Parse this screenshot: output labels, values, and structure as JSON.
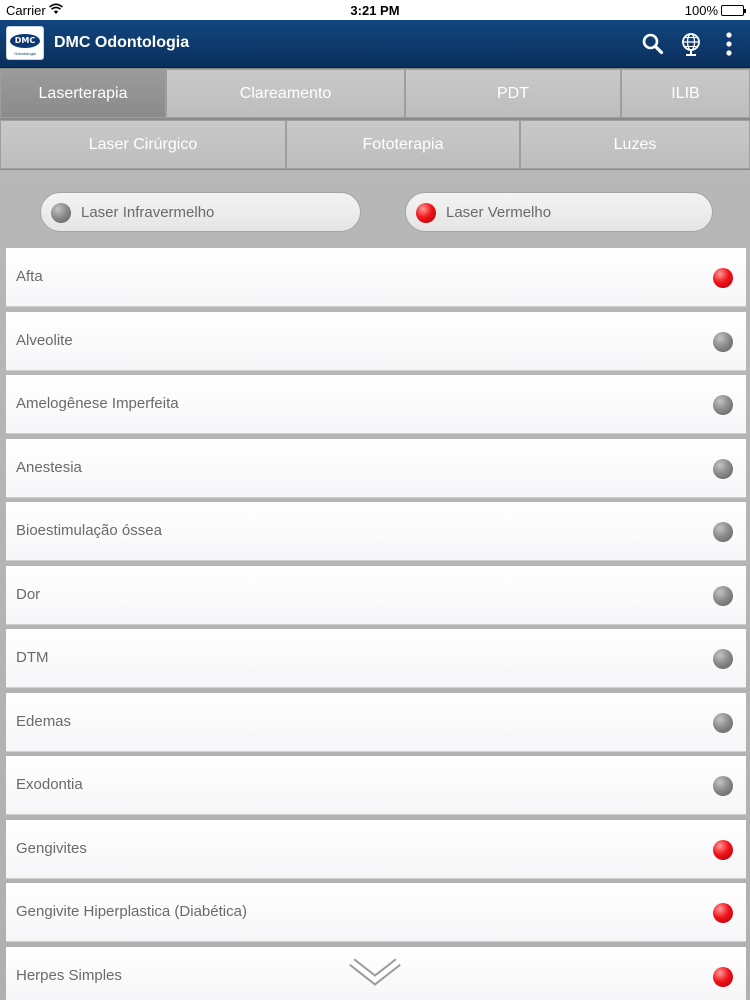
{
  "status_bar": {
    "carrier": "Carrier",
    "time": "3:21 PM",
    "battery": "100%"
  },
  "app": {
    "title": "DMC Odontologia",
    "logo_text": "DMC",
    "logo_subtext": "Odontologia"
  },
  "tabs_row1": [
    {
      "label": "Laserterapia",
      "active": true
    },
    {
      "label": "Clareamento",
      "active": false
    },
    {
      "label": "PDT",
      "active": false
    },
    {
      "label": "ILIB",
      "active": false
    }
  ],
  "tabs_row2": [
    {
      "label": "Laser Cirúrgico"
    },
    {
      "label": "Fototerapia"
    },
    {
      "label": "Luzes"
    }
  ],
  "filters": {
    "infrared": {
      "label": "Laser Infravermelho",
      "dot": "gray"
    },
    "red": {
      "label": "Laser Vermelho",
      "dot": "red"
    }
  },
  "list": [
    {
      "label": "Afta",
      "dot": "red"
    },
    {
      "label": "Alveolite",
      "dot": "gray"
    },
    {
      "label": "Amelogênese Imperfeita",
      "dot": "gray"
    },
    {
      "label": "Anestesia",
      "dot": "gray"
    },
    {
      "label": "Bioestimulação óssea",
      "dot": "gray"
    },
    {
      "label": "Dor",
      "dot": "gray"
    },
    {
      "label": "DTM",
      "dot": "gray"
    },
    {
      "label": "Edemas",
      "dot": "gray"
    },
    {
      "label": "Exodontia",
      "dot": "gray"
    },
    {
      "label": "Gengivites",
      "dot": "red"
    },
    {
      "label": "Gengivite Hiperplastica (Diabética)",
      "dot": "red"
    },
    {
      "label": "Herpes Simples",
      "dot": "red"
    }
  ],
  "colors": {
    "nav_bar": "#0f3f74",
    "red_dot": "#f0151a",
    "gray_dot": "#8c8c8c",
    "active_tab": "#8b8b8b"
  },
  "icons": {
    "search": "search-icon",
    "globe": "globe-icon",
    "menu": "more-vertical-icon",
    "scroll": "chevron-down-icon"
  }
}
